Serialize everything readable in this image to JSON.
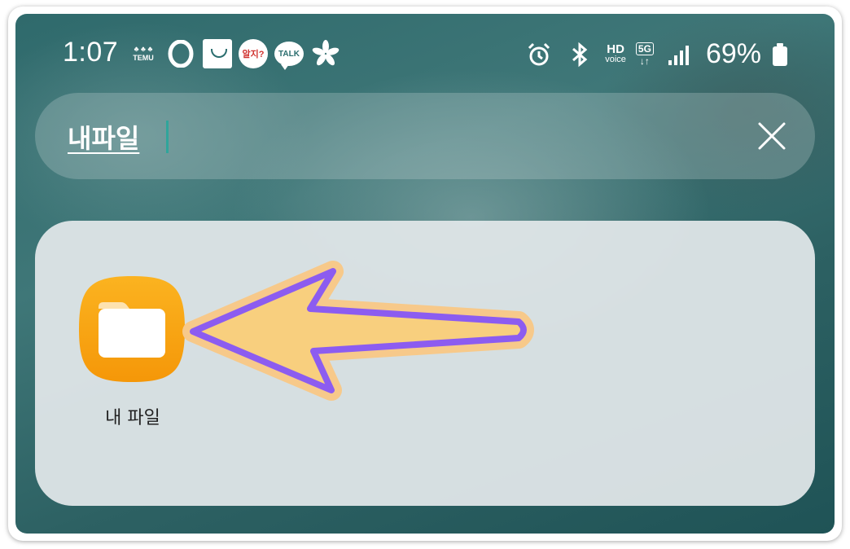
{
  "status_bar": {
    "time": "1:07",
    "temu_lines": [
      "TEMU"
    ],
    "circle_app_text": "알지?",
    "talk_label": "TALK",
    "hd_label": "HD",
    "voice_label": "voice",
    "network_label": "5G",
    "battery_percent": "69%"
  },
  "search": {
    "query": "내파일",
    "clear_icon": "close-icon"
  },
  "results": {
    "apps": [
      {
        "label": "내 파일",
        "icon": "folder-icon",
        "icon_color": "#f7a20b"
      }
    ]
  },
  "annotation": {
    "arrow_fill": "#f8cf7e",
    "arrow_stroke": "#8c5cf0"
  }
}
